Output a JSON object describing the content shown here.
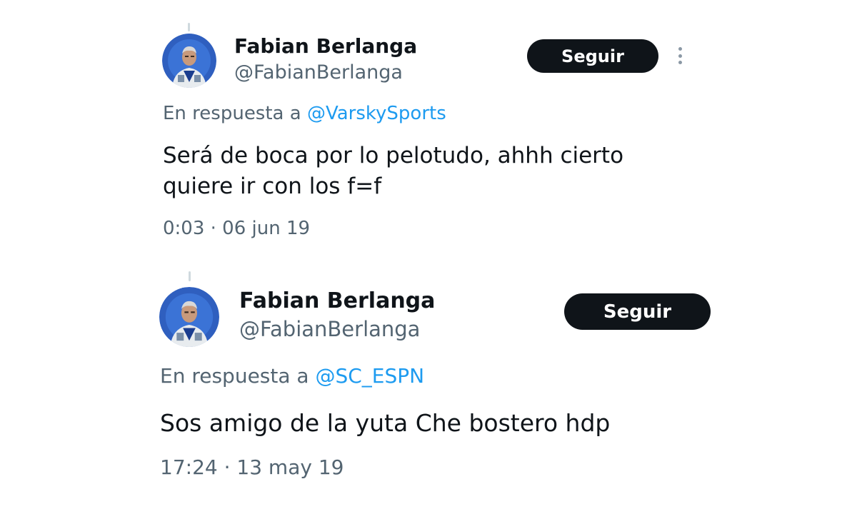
{
  "tweets": [
    {
      "author_name": "Fabian Berlanga",
      "author_handle": "@FabianBerlanga",
      "follow_label": "Seguir",
      "reply_prefix": "En respuesta a ",
      "reply_to": "@VarskySports",
      "text_line1": "Será de boca por lo pelotudo, ahhh cierto",
      "text_line2": "quiere ir con los f=f",
      "timestamp": "0:03 · 06 jun 19"
    },
    {
      "author_name": "Fabian Berlanga",
      "author_handle": "@FabianBerlanga",
      "follow_label": "Seguir",
      "reply_prefix": "En respuesta a ",
      "reply_to": "@SC_ESPN",
      "text_line1": "Sos amigo de la yuta Che bostero hdp",
      "timestamp": "17:24 · 13 may 19"
    }
  ],
  "icons": {
    "more": "more-vertical-icon",
    "avatar": "profile-photo"
  },
  "colors": {
    "follow_button_bg": "#0f1419",
    "mention": "#1d9bf0",
    "secondary_text": "#536471"
  }
}
